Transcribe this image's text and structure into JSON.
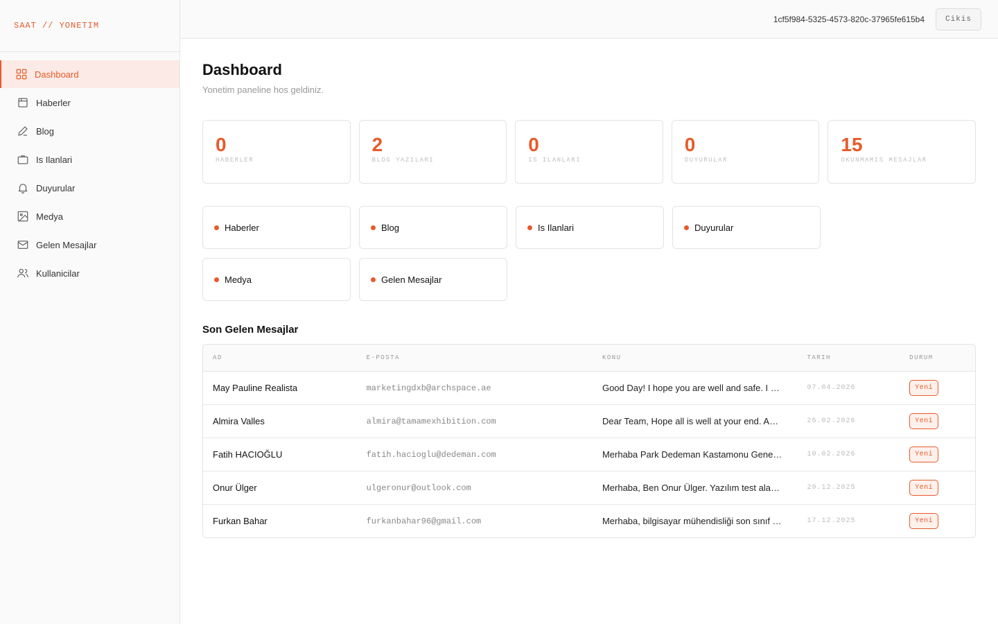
{
  "brand": "SAAT // YONETIM",
  "user_id": "1cf5f984-5325-4573-820c-37965fe615b4",
  "logout_label": "Cikis",
  "accent": "#e85a2a",
  "nav": [
    {
      "label": "Dashboard",
      "icon": "grid-icon",
      "active": true
    },
    {
      "label": "Haberler",
      "icon": "calendar-icon"
    },
    {
      "label": "Blog",
      "icon": "pencil-icon"
    },
    {
      "label": "Is Ilanlari",
      "icon": "briefcase-icon"
    },
    {
      "label": "Duyurular",
      "icon": "bell-icon"
    },
    {
      "label": "Medya",
      "icon": "image-icon"
    },
    {
      "label": "Gelen Mesajlar",
      "icon": "mail-icon"
    },
    {
      "label": "Kullanicilar",
      "icon": "users-icon"
    }
  ],
  "page": {
    "title": "Dashboard",
    "subtitle": "Yonetim paneline hos geldiniz."
  },
  "stats": [
    {
      "value": "0",
      "label": "HABERLER"
    },
    {
      "value": "2",
      "label": "BLOG YAZILARI"
    },
    {
      "value": "0",
      "label": "IS ILANLARI"
    },
    {
      "value": "0",
      "label": "DUYURULAR"
    },
    {
      "value": "15",
      "label": "OKUNMAMIS MESAJLAR"
    }
  ],
  "quick_links": [
    "Haberler",
    "Blog",
    "Is Ilanlari",
    "Duyurular",
    "Medya",
    "Gelen Mesajlar"
  ],
  "messages": {
    "title": "Son Gelen Mesajlar",
    "columns": [
      "AD",
      "E-POSTA",
      "KONU",
      "TARIH",
      "DURUM"
    ],
    "rows": [
      {
        "ad": "May Pauline Realista",
        "mail": "marketingdxb@archspace.ae",
        "konu": "Good Day! I hope you are well and safe. I a...",
        "tarih": "07.04.2026",
        "durum": "Yeni"
      },
      {
        "ad": "Almira Valles",
        "mail": "almira@tamamexhibition.com",
        "konu": "Dear Team, Hope all is well at your end. As ...",
        "tarih": "26.02.2026",
        "durum": "Yeni"
      },
      {
        "ad": "Fatih HACIOĞLU",
        "mail": "fatih.hacioglu@dedeman.com",
        "konu": "Merhaba Park Dedeman Kastamonu Genel ...",
        "tarih": "10.02.2026",
        "durum": "Yeni"
      },
      {
        "ad": "Onur Ülger",
        "mail": "ulgeronur@outlook.com",
        "konu": "Merhaba, Ben Onur Ülger. Yazılım test alanı...",
        "tarih": "29.12.2025",
        "durum": "Yeni"
      },
      {
        "ad": "Furkan Bahar",
        "mail": "furkanbahar96@gmail.com",
        "konu": "Merhaba, bilgisayar mühendisliği son sınıf ö...",
        "tarih": "17.12.2025",
        "durum": "Yeni"
      }
    ]
  }
}
